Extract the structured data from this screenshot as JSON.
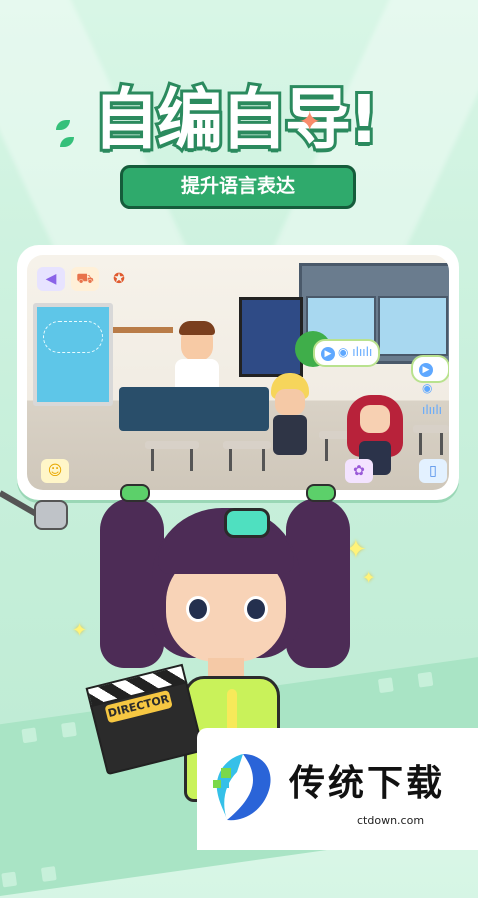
{
  "header": {
    "title": "自编自导!",
    "subtitle": "提升语言表达"
  },
  "scene": {
    "voice_bubble_1": "◉ ılıılı",
    "voice_bubble_2": "◉ ılıılı"
  },
  "clapper": {
    "label": "DIRECTOR"
  },
  "watermark": {
    "brand": "传统下载",
    "domain": "ctdown.com"
  },
  "colors": {
    "brand_green": "#2faa6c",
    "dark_green": "#155c3b",
    "background": "#c9f0dc"
  }
}
